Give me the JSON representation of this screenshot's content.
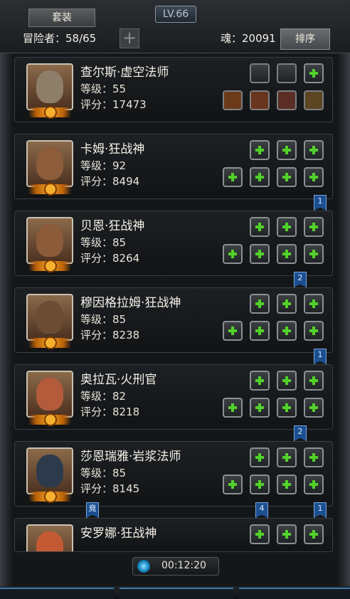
{
  "header": {
    "title_level": "LV.66",
    "set_button": "套装",
    "adventurer_label": "冒险者：58/65",
    "soul_label": "魂：20091",
    "sort_button": "排序"
  },
  "cards": [
    {
      "name": "查尔斯·虚空法师",
      "level": "等级：55",
      "score": "评分：17473",
      "face": "#8e7d69"
    },
    {
      "name": "卡姆·狂战神",
      "level": "等级：92",
      "score": "评分：8494",
      "face": "#8d5c3a"
    },
    {
      "name": "贝恩·狂战神",
      "level": "等级：85",
      "score": "评分：8264",
      "face": "#8c5b3a"
    },
    {
      "name": "穆因格拉姆·狂战神",
      "level": "等级：85",
      "score": "评分：8238",
      "face": "#6c4d34"
    },
    {
      "name": "奥拉瓦·火刑官",
      "level": "等级：82",
      "score": "评分：8218",
      "face": "#b35b3b"
    },
    {
      "name": "莎恩瑞雅·岩浆法师",
      "level": "等级：85",
      "score": "评分：8145",
      "face": "#2d3a4b"
    },
    {
      "name": "安罗娜·狂战神",
      "level": "",
      "score": "",
      "face": "#c45a33"
    }
  ],
  "ribbons": [
    {
      "text": "1"
    },
    {
      "text": "2"
    },
    {
      "text": "1"
    },
    {
      "text": "2"
    },
    {
      "text": "竟"
    },
    {
      "text": "4"
    },
    {
      "text": "1"
    }
  ],
  "timer": "00:12:20",
  "colors": {
    "plus": "#52d22a",
    "ribbon": "#1c4f8f",
    "accent": "#f7b02e"
  }
}
